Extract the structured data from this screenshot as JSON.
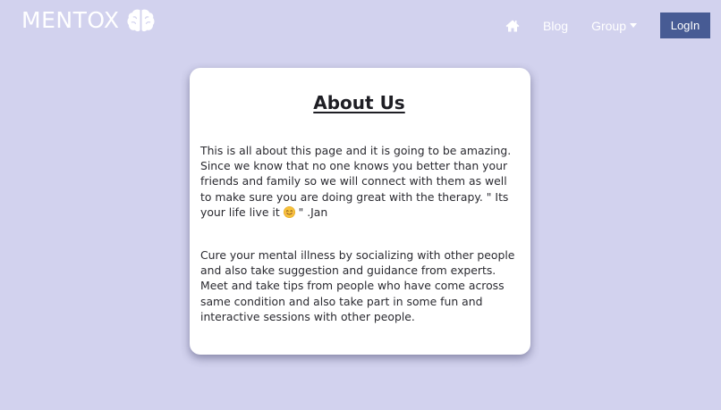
{
  "navbar": {
    "brand": "MENTOX",
    "brand_icon": "brain-icon",
    "home_icon": "home-icon",
    "blog_label": "Blog",
    "group_label": "Group",
    "login_label": "LogIn"
  },
  "about": {
    "title": "About Us",
    "paragraph1_before_emoji": "This is all about this page and it is going to be amazing. Since we know that no one knows you better than your friends and family so we will connect with them as well to make sure you are doing great with the therapy. \" Its your life live it ",
    "paragraph1_after_emoji": " \" .Jan",
    "paragraph2": "Cure your mental illness by socializing with other people and also take suggestion and guidance from experts. Meet and take tips from people who have come across same condition and also take part in some fun and interactive sessions with other people."
  },
  "colors": {
    "background": "#d2d2ee",
    "login_button": "#475b94",
    "card": "#ffffff"
  }
}
